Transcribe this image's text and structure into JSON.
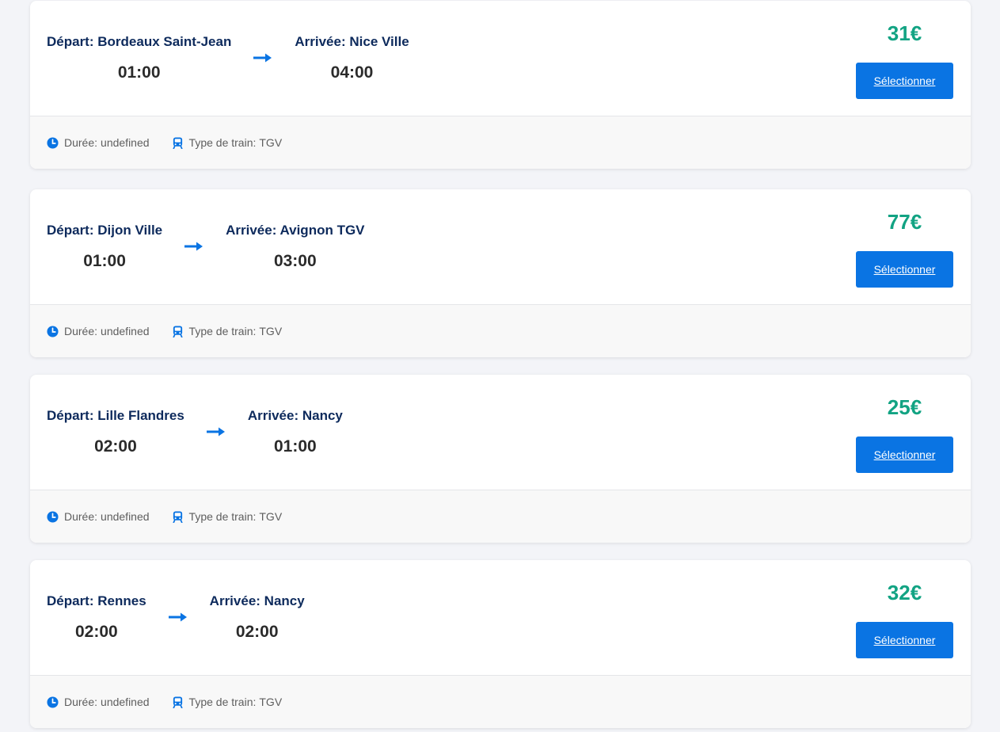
{
  "labels": {
    "depart_prefix": "Départ:",
    "arrive_prefix": "Arrivée:",
    "duration_prefix": "Durée:",
    "train_type_prefix": "Type de train:",
    "select_button": "Sélectionner"
  },
  "colors": {
    "page_background": "#f3f4f8",
    "station_text": "#0d2a5c",
    "price": "#12a383",
    "accent_blue": "#0a74e3"
  },
  "icons": {
    "route": "arrow-right-icon",
    "duration": "clock-icon",
    "train": "train-icon"
  },
  "trips": [
    {
      "departure": "Bordeaux Saint-Jean",
      "departure_time": "01:00",
      "arrival": "Nice Ville",
      "arrival_time": "04:00",
      "price": "31€",
      "duration": "undefined",
      "train_type": "TGV"
    },
    {
      "departure": "Dijon Ville",
      "departure_time": "01:00",
      "arrival": "Avignon TGV",
      "arrival_time": "03:00",
      "price": "77€",
      "duration": "undefined",
      "train_type": "TGV"
    },
    {
      "departure": "Lille Flandres",
      "departure_time": "02:00",
      "arrival": "Nancy",
      "arrival_time": "01:00",
      "price": "25€",
      "duration": "undefined",
      "train_type": "TGV"
    },
    {
      "departure": "Rennes",
      "departure_time": "02:00",
      "arrival": "Nancy",
      "arrival_time": "02:00",
      "price": "32€",
      "duration": "undefined",
      "train_type": "TGV"
    }
  ]
}
